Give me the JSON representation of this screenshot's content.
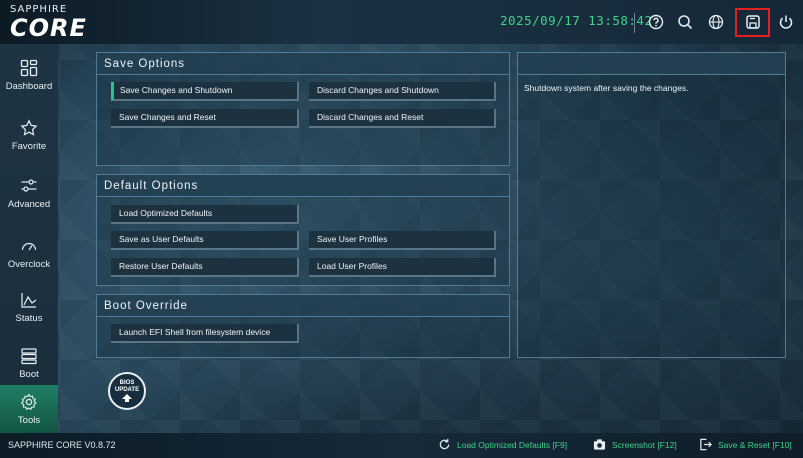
{
  "brand": {
    "small": "SAPPHIRE",
    "big": "CORE"
  },
  "header": {
    "datetime": "2025/09/17 13:58:42",
    "icons": [
      "help-icon",
      "search-icon",
      "globe-icon",
      "save-icon",
      "power-icon"
    ]
  },
  "sidebar": {
    "items": [
      {
        "label": "Dashboard",
        "icon": "dashboard-icon"
      },
      {
        "label": "Favorite",
        "icon": "star-icon"
      },
      {
        "label": "Advanced",
        "icon": "sliders-icon"
      },
      {
        "label": "Overclock",
        "icon": "gauge-icon"
      },
      {
        "label": "Status",
        "icon": "status-chart-icon"
      },
      {
        "label": "Boot",
        "icon": "boot-icon"
      },
      {
        "label": "Tools",
        "icon": "gear-icon"
      }
    ],
    "active": "Tools"
  },
  "save_options": {
    "title": "Save Options",
    "buttons": [
      "Save Changes and Shutdown",
      "Discard Changes and Shutdown",
      "Save Changes and Reset",
      "Discard Changes and Reset"
    ]
  },
  "default_options": {
    "title": "Default Options",
    "buttons": [
      "Load Optimized Defaults",
      "Save as User Defaults",
      "Save User Profiles",
      "Restore User Defaults",
      "Load User Profiles"
    ]
  },
  "boot_override": {
    "title": "Boot Override",
    "buttons": [
      "Launch EFI Shell from filesystem device"
    ]
  },
  "description": {
    "text": "Shutdown system after saving the changes."
  },
  "bios_update": {
    "line1": "BIOS",
    "line2": "UPDATE"
  },
  "footer": {
    "version": "SAPPHIRE CORE V0.8.72",
    "actions": [
      {
        "label": "Load Optimized Defaults [F9]",
        "icon": "refresh-icon"
      },
      {
        "label": "Screenshot [F12]",
        "icon": "camera-icon"
      },
      {
        "label": "Save & Reset [F10]",
        "icon": "exit-icon"
      }
    ]
  },
  "colors": {
    "accent": "#27c58a",
    "datetime": "#3fd28a",
    "highlight": "#e2201f",
    "active_nav": "#1f7f66"
  }
}
